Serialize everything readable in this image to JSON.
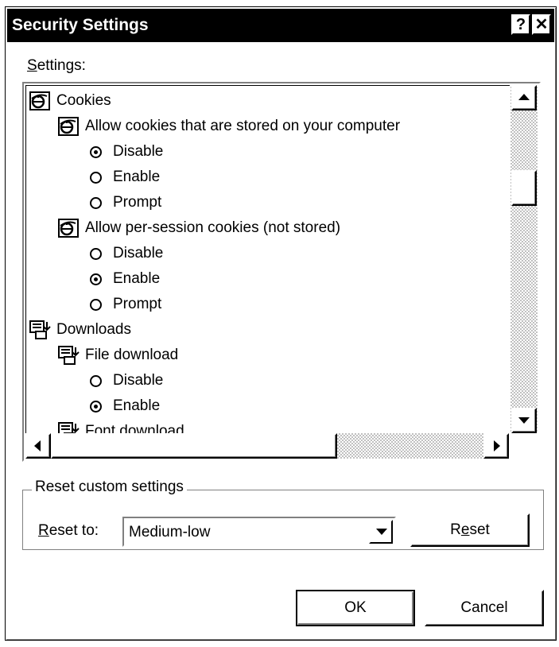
{
  "title": "Security Settings",
  "title_buttons": {
    "help": "?",
    "close": "✕"
  },
  "settings_label": {
    "mnemonic": "S",
    "rest": "ettings:"
  },
  "tree": [
    {
      "level": 0,
      "kind": "category",
      "icon": "ie-globe-icon",
      "label": "Cookies"
    },
    {
      "level": 1,
      "kind": "setting",
      "icon": "ie-globe-icon",
      "label": "Allow cookies that are stored on your computer"
    },
    {
      "level": 2,
      "kind": "option",
      "label": "Disable",
      "checked": true
    },
    {
      "level": 2,
      "kind": "option",
      "label": "Enable",
      "checked": false
    },
    {
      "level": 2,
      "kind": "option",
      "label": "Prompt",
      "checked": false
    },
    {
      "level": 1,
      "kind": "setting",
      "icon": "ie-globe-icon",
      "label": "Allow per-session cookies (not stored)"
    },
    {
      "level": 2,
      "kind": "option",
      "label": "Disable",
      "checked": false
    },
    {
      "level": 2,
      "kind": "option",
      "label": "Enable",
      "checked": true
    },
    {
      "level": 2,
      "kind": "option",
      "label": "Prompt",
      "checked": false
    },
    {
      "level": 0,
      "kind": "category",
      "icon": "download-icon",
      "label": "Downloads"
    },
    {
      "level": 1,
      "kind": "setting",
      "icon": "download-icon",
      "label": "File download"
    },
    {
      "level": 2,
      "kind": "option",
      "label": "Disable",
      "checked": false
    },
    {
      "level": 2,
      "kind": "option",
      "label": "Enable",
      "checked": true
    },
    {
      "level": 1,
      "kind": "setting",
      "icon": "download-icon",
      "label": "Font download"
    }
  ],
  "reset_group": {
    "legend": "Reset custom settings",
    "reset_to_label": {
      "mnemonic": "R",
      "rest": "eset to:"
    },
    "reset_to_value": "Medium-low",
    "reset_button": {
      "pre": "R",
      "mnemonic": "e",
      "post": "set"
    }
  },
  "ok_label": "OK",
  "cancel_label": "Cancel"
}
